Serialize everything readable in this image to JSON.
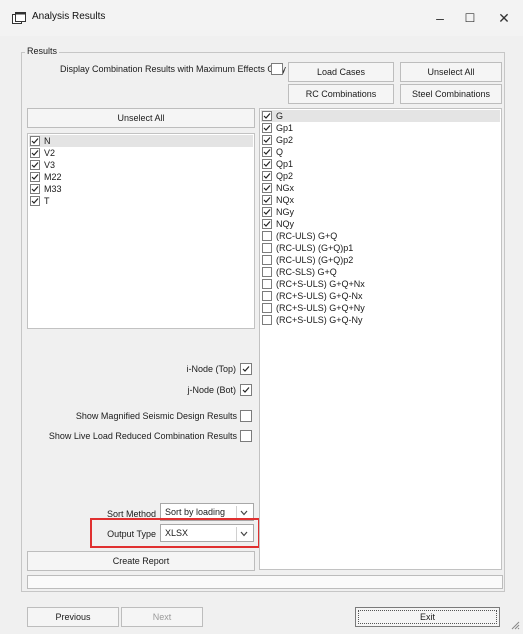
{
  "window": {
    "title": "Analysis Results",
    "minimize": "–",
    "maximize": "☐",
    "close": "✕"
  },
  "results": {
    "legend": "Results",
    "display_combo_label": "Display Combination Results with Maximum Effects Only",
    "buttons": {
      "load_cases": "Load Cases",
      "unselect_all_top": "Unselect All",
      "rc_combinations": "RC Combinations",
      "steel_combinations": "Steel Combinations",
      "unselect_all_left": "Unselect All",
      "create_report": "Create Report"
    },
    "force_list": [
      {
        "label": "N",
        "checked": true
      },
      {
        "label": "V2",
        "checked": true
      },
      {
        "label": "V3",
        "checked": true
      },
      {
        "label": "M22",
        "checked": true
      },
      {
        "label": "M33",
        "checked": true
      },
      {
        "label": "T",
        "checked": true
      }
    ],
    "i_node_label": "i-Node (Top)",
    "j_node_label": "j-Node (Bot)",
    "show_seismic_label": "Show Magnified Seismic Design Results",
    "show_live_load_label": "Show Live Load Reduced Combination Results",
    "sort_method": {
      "label": "Sort Method",
      "value": "Sort by loading"
    },
    "output_type": {
      "label": "Output Type",
      "value": "XLSX"
    },
    "case_list": [
      {
        "label": "G",
        "checked": true
      },
      {
        "label": "Gp1",
        "checked": true
      },
      {
        "label": "Gp2",
        "checked": true
      },
      {
        "label": "Q",
        "checked": true
      },
      {
        "label": "Qp1",
        "checked": true
      },
      {
        "label": "Qp2",
        "checked": true
      },
      {
        "label": "NGx",
        "checked": true
      },
      {
        "label": "NQx",
        "checked": true
      },
      {
        "label": "NGy",
        "checked": true
      },
      {
        "label": "NQy",
        "checked": true
      },
      {
        "label": "(RC-ULS) G+Q",
        "checked": false
      },
      {
        "label": "(RC-ULS) (G+Q)p1",
        "checked": false
      },
      {
        "label": "(RC-ULS) (G+Q)p2",
        "checked": false
      },
      {
        "label": "(RC-SLS) G+Q",
        "checked": false
      },
      {
        "label": "(RC+S-ULS) G+Q+Nx",
        "checked": false
      },
      {
        "label": "(RC+S-ULS) G+Q-Nx",
        "checked": false
      },
      {
        "label": "(RC+S-ULS) G+Q+Ny",
        "checked": false
      },
      {
        "label": "(RC+S-ULS) G+Q-Ny",
        "checked": false
      }
    ]
  },
  "footer": {
    "previous": "Previous",
    "next": "Next",
    "exit": "Exit"
  },
  "colors": {
    "highlight": "#e03030",
    "selected_row": "#e4e4e4"
  }
}
